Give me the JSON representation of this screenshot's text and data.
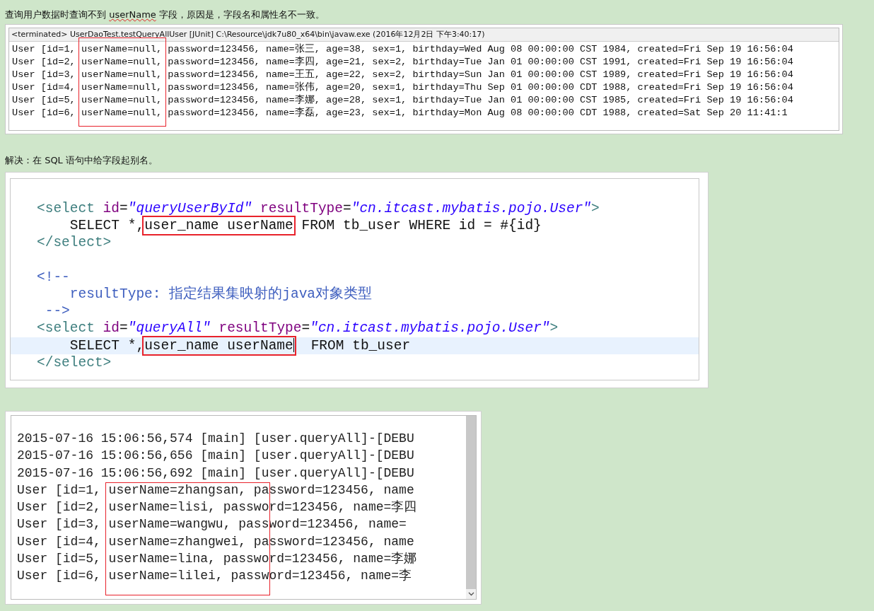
{
  "intro": {
    "text_before": "查询用户数据时查询不到 ",
    "flagged_word": "userName",
    "text_after": " 字段，原因是，字段名和属性名不一致。"
  },
  "console_top": {
    "header": "<terminated> UserDaoTest.testQueryAllUser [JUnit] C:\\Resource\\jdk7u80_x64\\bin\\javaw.exe (2016年12月2日 下午3:40:17)",
    "lines": [
      "User [id=1, userName=null, password=123456, name=张三, age=38, sex=1, birthday=Wed Aug 08 00:00:00 CST 1984, created=Fri Sep 19 16:56:04",
      "User [id=2, userName=null, password=123456, name=李四, age=21, sex=2, birthday=Tue Jan 01 00:00:00 CST 1991, created=Fri Sep 19 16:56:04",
      "User [id=3, userName=null, password=123456, name=王五, age=22, sex=2, birthday=Sun Jan 01 00:00:00 CST 1989, created=Fri Sep 19 16:56:04",
      "User [id=4, userName=null, password=123456, name=张伟, age=20, sex=1, birthday=Thu Sep 01 00:00:00 CDT 1988, created=Fri Sep 19 16:56:04",
      "User [id=5, userName=null, password=123456, name=李娜, age=28, sex=1, birthday=Tue Jan 01 00:00:00 CST 1985, created=Fri Sep 19 16:56:04",
      "User [id=6, userName=null, password=123456, name=李磊, age=23, sex=1, birthday=Mon Aug 08 00:00:00 CDT 1988, created=Sat Sep 20 11:41:1"
    ]
  },
  "solution": "解决：在 SQL 语句中给字段起别名。",
  "code_editor": {
    "lines": [
      {
        "current": false,
        "segments": [
          {
            "kind": "tag",
            "text": "<select"
          },
          {
            "kind": "attr",
            "text": " id"
          },
          {
            "kind": "plain",
            "text": "="
          },
          {
            "kind": "value",
            "text": "\"queryUserById\""
          },
          {
            "kind": "attr",
            "text": " resultType"
          },
          {
            "kind": "plain",
            "text": "="
          },
          {
            "kind": "value",
            "text": "\"cn.itcast.mybatis.pojo.User\""
          },
          {
            "kind": "tag",
            "text": ">"
          }
        ]
      },
      {
        "current": false,
        "segments": [
          {
            "kind": "plain",
            "text": "    SELECT *,"
          },
          {
            "kind": "boxed",
            "text": "user_name userName"
          },
          {
            "kind": "plain",
            "text": " FROM tb_user WHERE id = #{id}"
          }
        ]
      },
      {
        "current": false,
        "segments": [
          {
            "kind": "tag",
            "text": "</select>"
          }
        ]
      },
      {
        "current": false
      },
      {
        "current": false,
        "segments": [
          {
            "kind": "comment",
            "text": "<!--"
          }
        ]
      },
      {
        "current": false,
        "segments": [
          {
            "kind": "comment",
            "text": "    resultType: 指定结果集映射的java对象类型"
          }
        ]
      },
      {
        "current": false,
        "segments": [
          {
            "kind": "comment",
            "text": " -->"
          }
        ]
      },
      {
        "current": false,
        "segments": [
          {
            "kind": "tag",
            "text": "<select"
          },
          {
            "kind": "attr",
            "text": " id"
          },
          {
            "kind": "plain",
            "text": "="
          },
          {
            "kind": "value",
            "text": "\"queryAll\""
          },
          {
            "kind": "attr",
            "text": " resultType"
          },
          {
            "kind": "plain",
            "text": "="
          },
          {
            "kind": "value",
            "text": "\"cn.itcast.mybatis.pojo.User\""
          },
          {
            "kind": "tag",
            "text": ">"
          }
        ]
      },
      {
        "current": true,
        "segments": [
          {
            "kind": "plain",
            "text": "    SELECT *,"
          },
          {
            "kind": "boxed",
            "text": "user_name userName"
          },
          {
            "kind": "plain",
            "text": "  FROM tb_user"
          }
        ]
      },
      {
        "current": false,
        "segments": [
          {
            "kind": "tag",
            "text": "</select>"
          }
        ]
      }
    ]
  },
  "console_bottom": {
    "lines": [
      "2015-07-16 15:06:56,574 [main] [user.queryAll]-[DEBU",
      "2015-07-16 15:06:56,656 [main] [user.queryAll]-[DEBU",
      "2015-07-16 15:06:56,692 [main] [user.queryAll]-[DEBU",
      "User [id=1, userName=zhangsan, password=123456, name",
      "User [id=2, userName=lisi, password=123456, name=李四",
      "User [id=3, userName=wangwu, password=123456, name=",
      "User [id=4, userName=zhangwei, password=123456, name",
      "User [id=5, userName=lina, password=123456, name=李娜",
      "User [id=6, userName=lilei, password=123456, name=李"
    ]
  }
}
